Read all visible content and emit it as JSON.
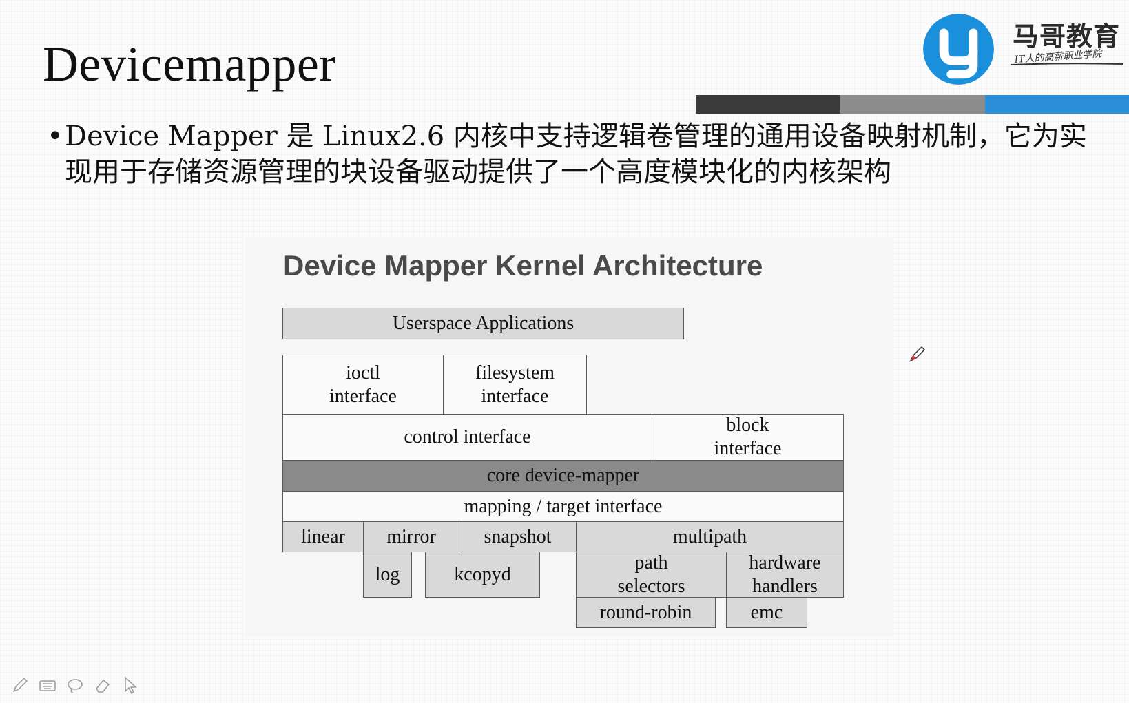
{
  "slide": {
    "title": "Devicemapper",
    "bullet": "Device Mapper 是 Linux2.6 内核中支持逻辑卷管理的通用设备映射机制，它为实现用于存储资源管理的块设备驱动提供了一个高度模块化的内核架构"
  },
  "logo": {
    "name": "马哥教育",
    "tagline": "IT人的高薪职业学院",
    "icon": "mage-logo-icon",
    "accent": "#2a8fd8"
  },
  "diagram": {
    "title": "Device Mapper Kernel Architecture",
    "boxes": {
      "userspace": "Userspace Applications",
      "ioctl": "ioctl\ninterface",
      "filesystem": "filesystem\ninterface",
      "control": "control interface",
      "block": "block\ninterface",
      "core": "core device-mapper",
      "mapping": "mapping / target interface",
      "linear": "linear",
      "mirror": "mirror",
      "snapshot": "snapshot",
      "multipath": "multipath",
      "log": "log",
      "kcopyd": "kcopyd",
      "path_selectors": "path\nselectors",
      "hardware_handlers": "hardware\nhandlers",
      "round_robin": "round-robin",
      "emc": "emc"
    }
  },
  "toolbar": {
    "icons": [
      "pen-icon",
      "keyboard-icon",
      "lasso-icon",
      "eraser-icon",
      "pointer-icon"
    ]
  }
}
